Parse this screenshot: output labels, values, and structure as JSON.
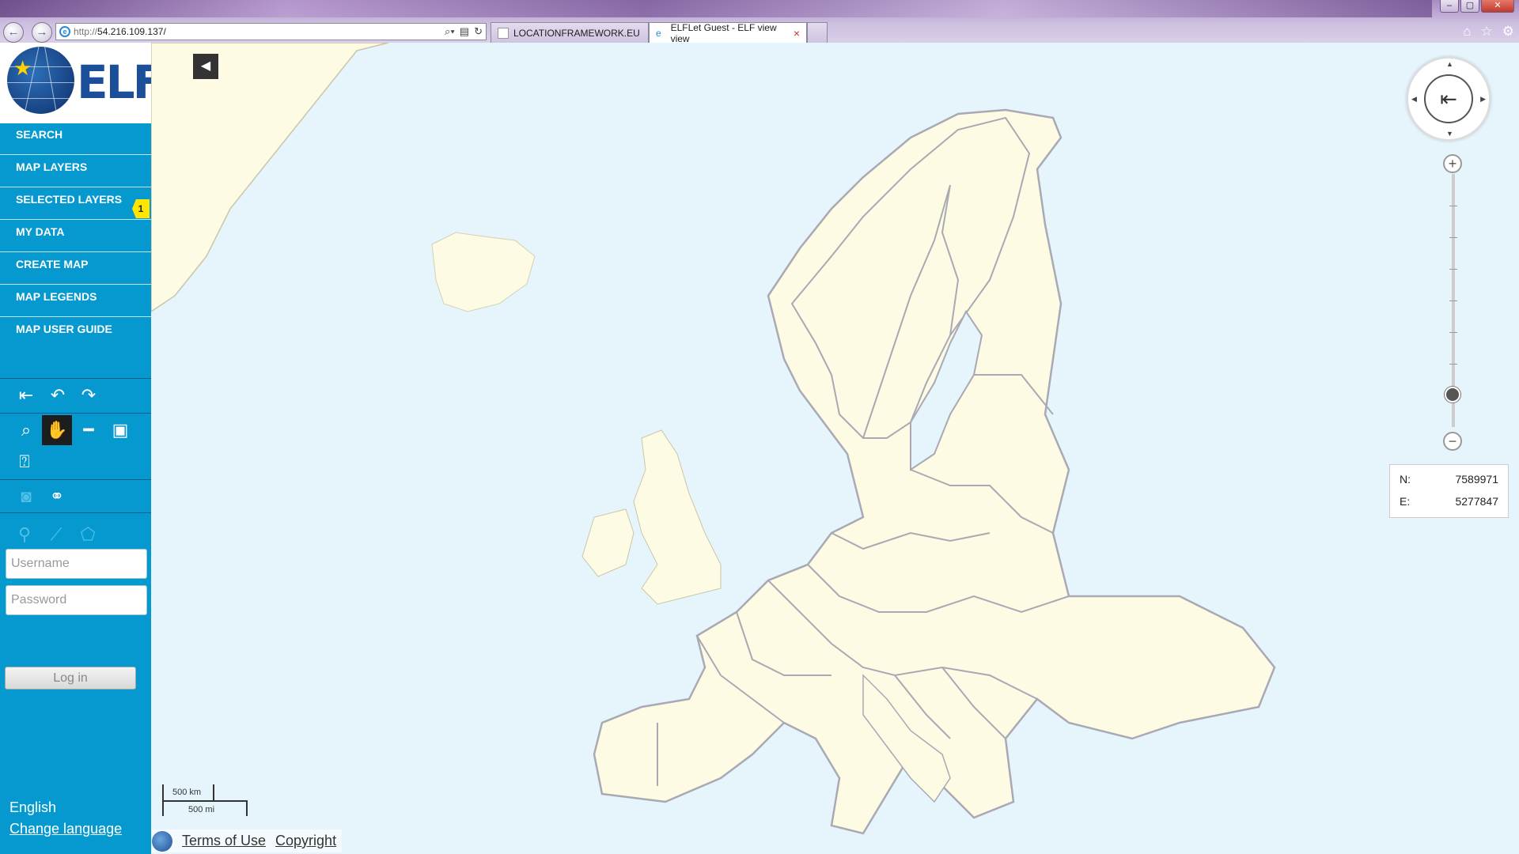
{
  "browser": {
    "url_prefix": "http://",
    "url": "54.216.109.137/",
    "tabs": [
      {
        "label": "LOCATIONFRAMEWORK.EU",
        "active": false
      },
      {
        "label": "ELFLet Guest - ELF view view",
        "active": true
      }
    ],
    "close_tab_glyph": "×",
    "window_controls": [
      "minimize",
      "maximize",
      "close"
    ]
  },
  "logo": {
    "text": "ELF"
  },
  "sidebar": {
    "menu": [
      {
        "label": "SEARCH"
      },
      {
        "label": "MAP LAYERS"
      },
      {
        "label": "SELECTED LAYERS",
        "badge": "1"
      },
      {
        "label": "MY DATA"
      },
      {
        "label": "CREATE MAP"
      },
      {
        "label": "MAP LEGENDS"
      },
      {
        "label": "MAP USER GUIDE"
      }
    ],
    "toolbar": {
      "history": [
        "reset-view-icon",
        "undo-icon",
        "redo-icon"
      ],
      "map_tools": [
        "zoom-box-icon",
        "pan-hand-icon",
        "measure-line-icon",
        "measure-area-icon",
        "get-info-icon"
      ],
      "share": [
        "snapshot-icon",
        "link-icon"
      ],
      "editing": [
        "add-point-icon",
        "add-line-icon",
        "add-area-icon"
      ]
    },
    "login": {
      "username_placeholder": "Username",
      "password_placeholder": "Password",
      "button": "Log in"
    },
    "language": "English",
    "change_language": "Change language"
  },
  "map": {
    "coordinates": {
      "n_label": "N:",
      "n_value": "7589971",
      "e_label": "E:",
      "e_value": "5277847"
    },
    "scale": {
      "km": "500 km",
      "mi": "500 mi"
    },
    "zoom_level_fraction": 0.8,
    "footer": {
      "terms": "Terms of Use",
      "copyright": "Copyright"
    },
    "colors": {
      "sea": "#e6f4fb",
      "land": "#fdfbe3",
      "borders": "#a9a9b4",
      "sidebar": "#0599d0"
    }
  }
}
